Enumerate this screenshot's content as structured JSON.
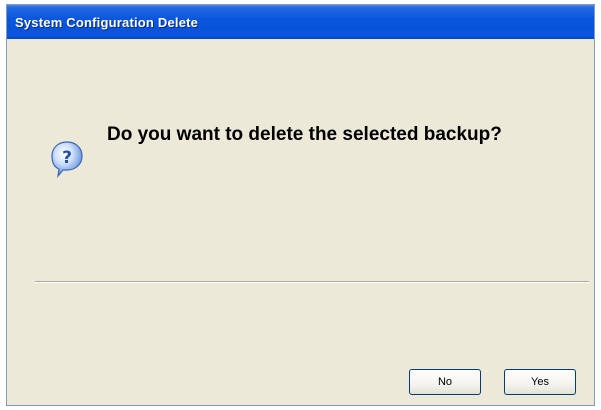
{
  "window": {
    "title": "System Configuration Delete"
  },
  "dialog": {
    "icon": "question-icon",
    "message": "Do you want to delete the selected backup?"
  },
  "buttons": {
    "no_label": "No",
    "yes_label": "Yes"
  },
  "colors": {
    "titlebar": "#0a57df",
    "background": "#ece9d8",
    "icon": "#2a6fd6"
  }
}
